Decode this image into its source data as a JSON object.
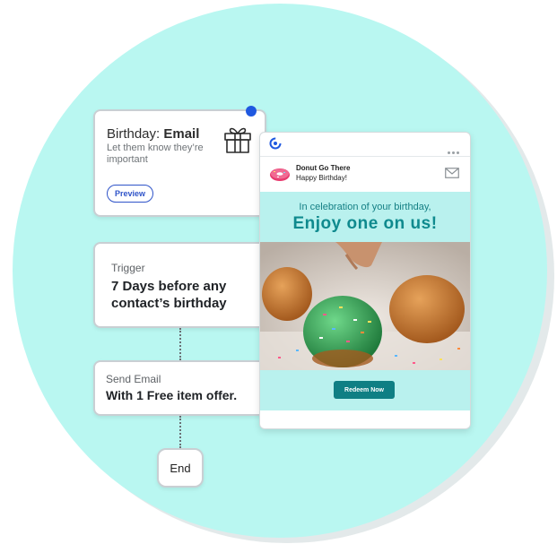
{
  "birthday_card": {
    "title_prefix": "Birthday: ",
    "title_bold": "Email",
    "subtitle": "Let them know they’re important",
    "preview_label": "Preview",
    "icon": "gift-icon"
  },
  "trigger_card": {
    "label": "Trigger",
    "text": "7 Days before any contact’s birthday"
  },
  "send_card": {
    "label": "Send Email",
    "text": "With 1 Free item offer."
  },
  "end_card": {
    "label": "End"
  },
  "email_preview": {
    "sender_name": "Donut Go There",
    "subject": "Happy Birthday!",
    "headline_small": "In celebration of your birthday,",
    "headline_large": "Enjoy one on us!",
    "cta_label": "Redeem Now",
    "icons": [
      "constant-contact-logo-icon",
      "more-dots-icon",
      "donut-avatar-icon",
      "envelope-icon"
    ]
  },
  "colors": {
    "background_circle": "#b9f7f1",
    "accent_blue": "#1f58e0",
    "email_teal": "#b9f1ee",
    "headline_teal": "#0f8a8e",
    "button_teal": "#0f7f84"
  }
}
